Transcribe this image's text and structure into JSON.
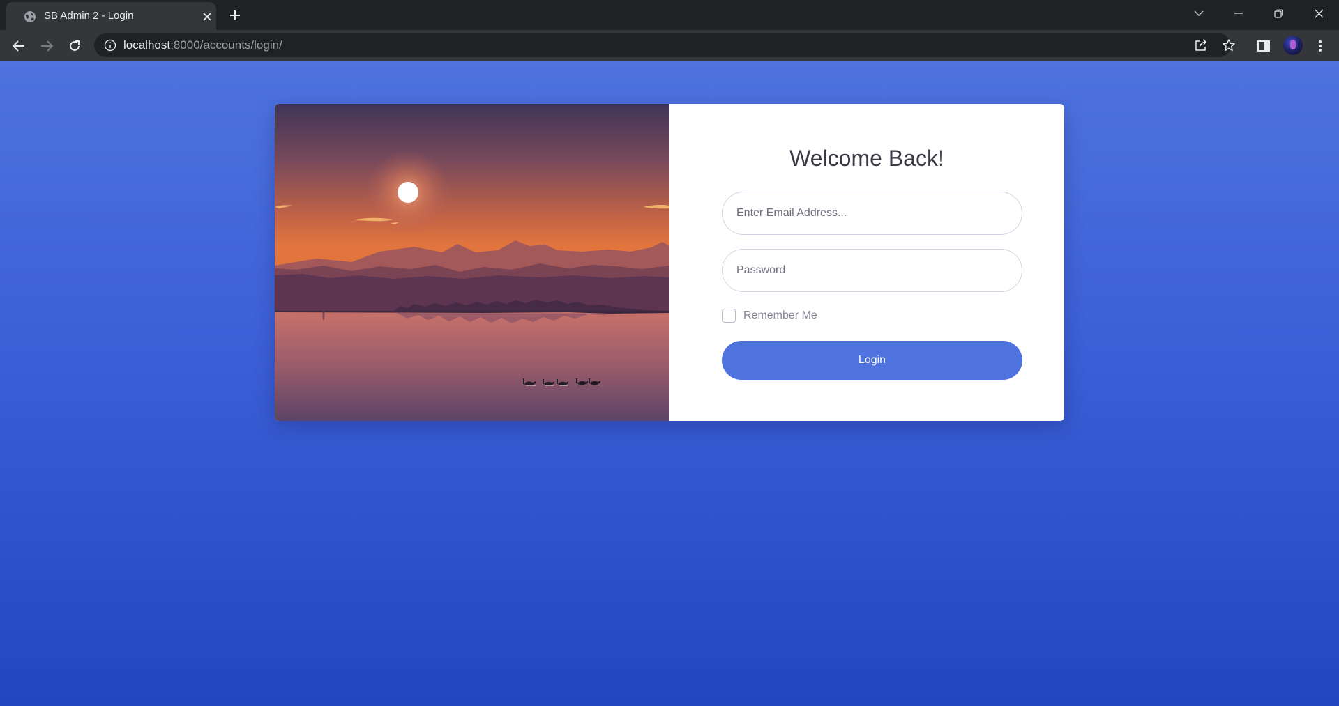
{
  "browser": {
    "tab_title": "SB Admin 2 - Login",
    "url_host": "localhost",
    "url_path": ":8000/accounts/login/"
  },
  "login": {
    "heading": "Welcome Back!",
    "email_placeholder": "Enter Email Address...",
    "password_placeholder": "Password",
    "remember_label": "Remember Me",
    "remember_checked": false,
    "submit_label": "Login"
  },
  "colors": {
    "primary": "#4e73df",
    "background_top": "#4e73df",
    "background_bottom": "#2246be"
  },
  "icons": [
    "globe-icon",
    "close-icon",
    "plus-icon",
    "chevron-down-icon",
    "minimize-icon",
    "restore-icon",
    "window-close-icon",
    "back-arrow-icon",
    "forward-arrow-icon",
    "reload-icon",
    "info-icon",
    "share-icon",
    "star-icon",
    "side-panel-icon",
    "menu-icon"
  ]
}
